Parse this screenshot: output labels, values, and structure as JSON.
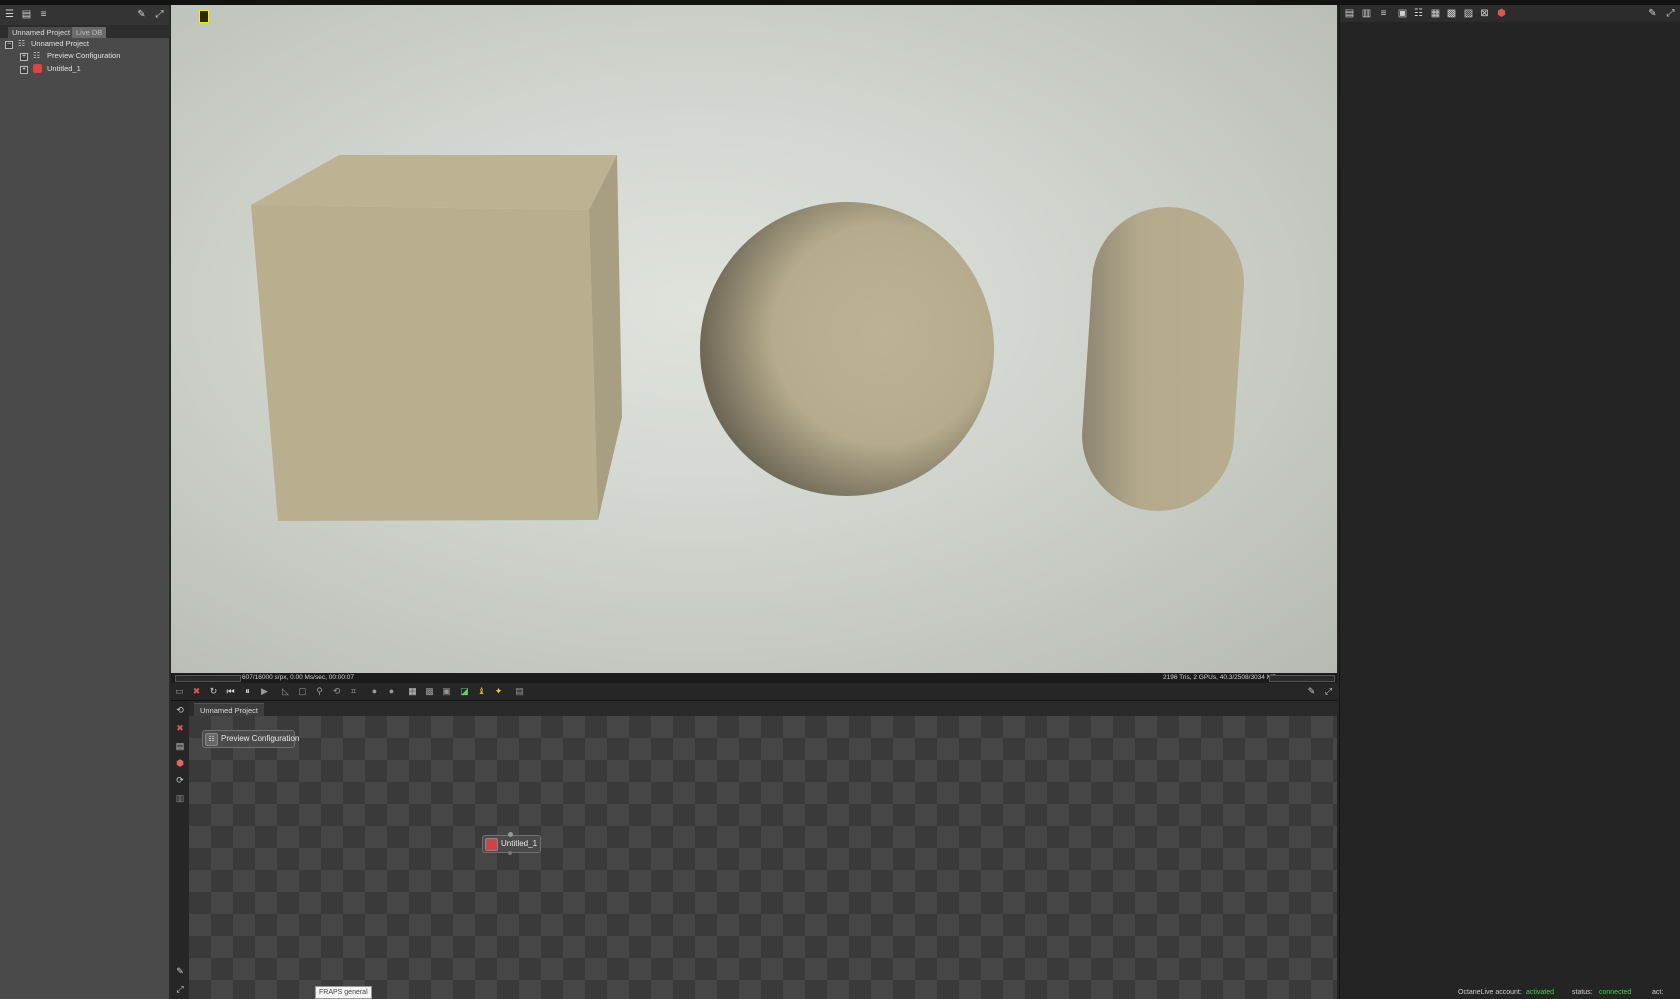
{
  "left_panel": {
    "tabs": [
      {
        "label": "Unnamed Project"
      },
      {
        "label": "Live DB"
      }
    ],
    "tree": {
      "root_label": "Unnamed Project",
      "children": [
        {
          "label": "Preview Configuration"
        },
        {
          "label": "Untitled_1"
        }
      ]
    }
  },
  "viewport": {
    "status_left": "607/16000 s/px, 0.00 Ms/sec, 00:00:07",
    "status_right": "2196 Tris, 2 GPUs, 40.3/2508/3034 MB",
    "objects": [
      "cube",
      "sphere",
      "capsule"
    ],
    "object_color": "#b9ad8e"
  },
  "node_graph": {
    "tab_label": "Unnamed Project",
    "nodes": [
      {
        "label": "Preview Configuration"
      },
      {
        "label": "Untitled_1"
      }
    ],
    "tooltip": "FRAPS general"
  },
  "right_panel": {
    "account_label": "OctaneLive account:",
    "account_value": "activated",
    "status_label": "status:",
    "status_value": "connected",
    "act_label": "act:"
  },
  "colors": {
    "accent_green": "#3dd93d",
    "render_region_yellow": "#ffea00"
  }
}
